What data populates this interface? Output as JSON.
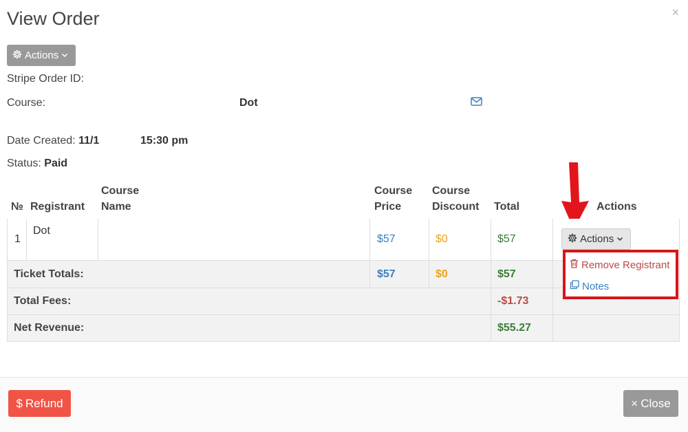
{
  "modal": {
    "title": "View Order",
    "close_glyph": "×"
  },
  "top_actions": {
    "label": "Actions",
    "icon": "gear-icon"
  },
  "info": {
    "stripe_label": "Stripe Order ID:",
    "course_label": "Course:",
    "course_value": "Dot",
    "date_label": "Date Created:",
    "date_part1": "11/1",
    "date_part2": "15:30 pm",
    "status_label": "Status:",
    "status_value": "Paid"
  },
  "table": {
    "headers": {
      "num": "№",
      "registrant": "Registrant",
      "course_name_1": "Course",
      "course_name_2": "Name",
      "course_price_1": "Course",
      "course_price_2": "Price",
      "course_discount_1": "Course",
      "course_discount_2": "Discount",
      "total": "Total",
      "actions": "Actions"
    },
    "row": {
      "num": "1",
      "registrant": "Dot",
      "course_name": "",
      "price": "$57",
      "discount": "$0",
      "total": "$57",
      "actions_label": "Actions"
    },
    "ticket_totals": {
      "label": "Ticket Totals:",
      "price": "$57",
      "discount": "$0",
      "total": "$57"
    },
    "total_fees": {
      "label": "Total Fees:",
      "total": "-$1.73"
    },
    "net_revenue": {
      "label": "Net Revenue:",
      "total": "$55.27"
    }
  },
  "dropdown": {
    "items": [
      {
        "label": "Remove Registrant",
        "icon": "trash-icon",
        "color": "#b94a48"
      },
      {
        "label": "Notes",
        "icon": "copy-icon",
        "color": "#3a7fc1"
      }
    ],
    "highlight_color": "#d9141a"
  },
  "footer": {
    "refund_label": "Refund",
    "refund_glyph": "$",
    "close_label": "Close",
    "close_glyph": "×"
  }
}
